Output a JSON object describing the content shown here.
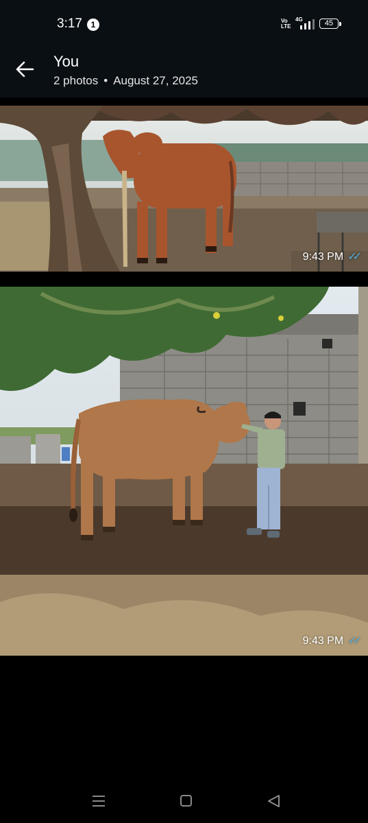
{
  "status_bar": {
    "time": "3:17",
    "notification_count": "1",
    "volte": "Vo LTE",
    "network": "4G",
    "battery": "45"
  },
  "header": {
    "back_icon": "arrow-left-icon",
    "title": "You",
    "photo_count": "2 photos",
    "separator": "•",
    "date": "August 27, 2025"
  },
  "photos": [
    {
      "time": "9:43 PM",
      "status_icon": "double-check-icon"
    },
    {
      "time": "9:43 PM",
      "status_icon": "double-check-icon"
    }
  ],
  "nav_bar": {
    "icons": [
      "menu-icon",
      "home-icon",
      "back-triangle-icon"
    ]
  },
  "colors": {
    "background": "#000000",
    "bar": "#0a0f14",
    "read_ticks": "#54b3e6"
  }
}
